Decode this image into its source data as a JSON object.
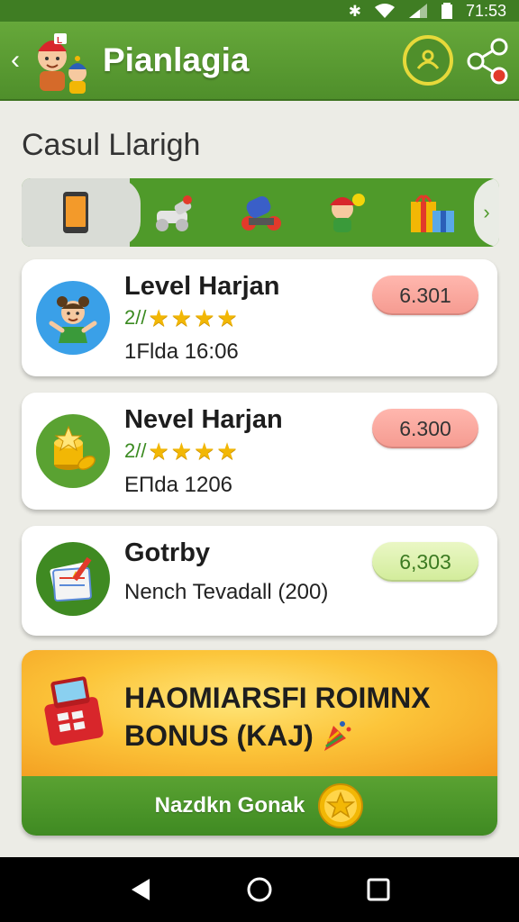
{
  "status_bar": {
    "time": "71:53",
    "icons": [
      "bluetooth-icon",
      "wifi-icon",
      "signal-icon",
      "battery-icon"
    ]
  },
  "app_bar": {
    "title": "Pianlagia",
    "icons": [
      "back-icon",
      "logo-characters",
      "profile-ring-icon",
      "share-icon"
    ]
  },
  "section_title": "Casul Llarigh",
  "category_strip": {
    "items": [
      "phone-icon",
      "toy-cannon-icon",
      "toy-vehicle-icon",
      "character-icon",
      "gift-icon"
    ],
    "more_label": "›"
  },
  "cards": [
    {
      "title": "Level Harjan",
      "rating_text": "2//",
      "stars": 4,
      "subtitle": "1Flda 16:06",
      "pill": "6.301",
      "pill_color": "#f59a90",
      "icon": "kid-avatar-icon"
    },
    {
      "title": "Nevel Harjan",
      "rating_text": "2//",
      "stars": 4,
      "subtitle": "ЕПda 1206",
      "pill": "6.300",
      "pill_color": "#f59a90",
      "icon": "gold-coins-icon"
    },
    {
      "title": "Gotrby",
      "subtitle": "Nench Tevadall (200)",
      "pill": "6,303",
      "pill_color": "#d2ec9a",
      "icon": "notebook-pencil-icon"
    }
  ],
  "bonus": {
    "title_line1": "HAOMIARSFI ROIMNX",
    "title_line2": "BONUS (KAJ)",
    "cta": "Nazdkn Gonak",
    "icons": [
      "cash-register-icon",
      "party-popper-icon",
      "gold-star-coin-icon"
    ]
  },
  "nav_bar": {
    "icons": [
      "nav-back-icon",
      "nav-home-icon",
      "nav-recents-icon"
    ]
  },
  "colors": {
    "app_green": "#4f8f2b",
    "status_green": "#3f7d23",
    "ring_yellow": "#e6d93a",
    "pill_red": "#f59a90",
    "pill_green": "#d2ec9a",
    "bonus_orange": "#fcc53a"
  }
}
